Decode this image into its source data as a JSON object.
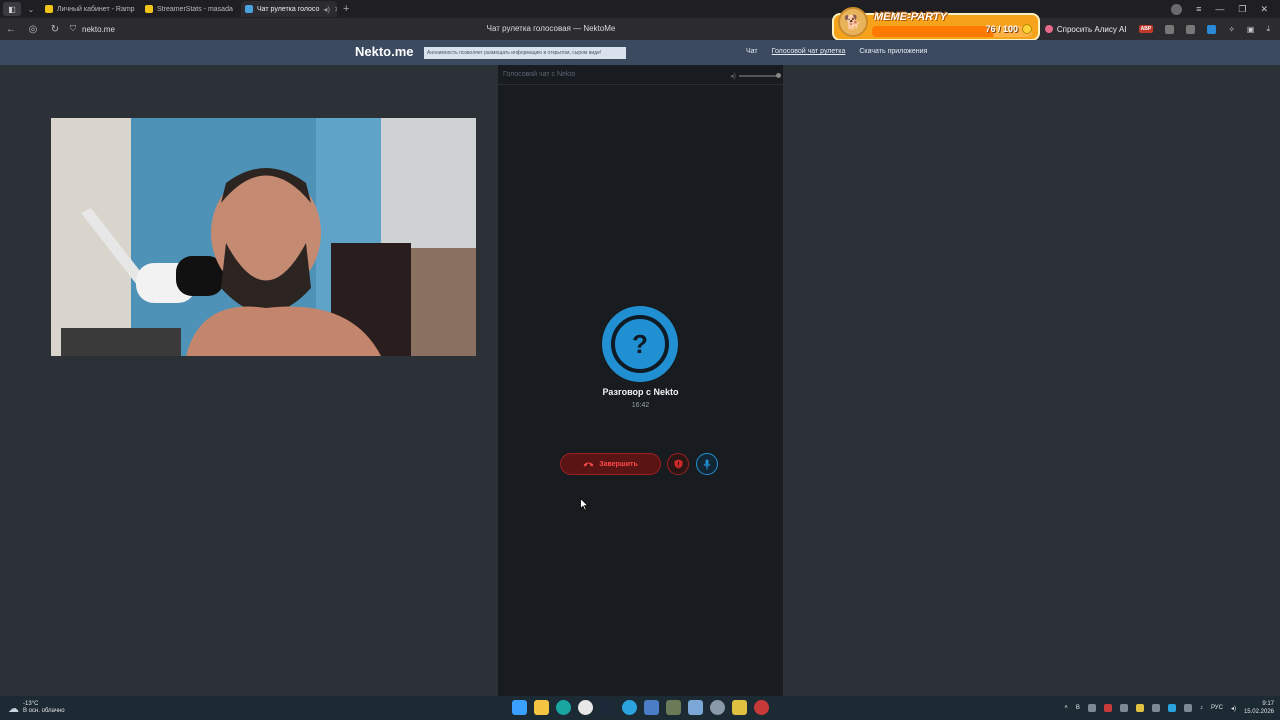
{
  "browser": {
    "tabs": [
      {
        "label": "Личный кабинет - Ramp",
        "favicon_color": "#f0c419",
        "active": false
      },
      {
        "label": "StreamerStats - masada",
        "favicon_color": "#f0c419",
        "active": false
      },
      {
        "label": "Чат рулетка голосо",
        "favicon_color": "#4aa3df",
        "active": true
      }
    ],
    "url": "nekto.me",
    "page_title": "Чат рулетка голосовая — NektoMe",
    "alice_label": "Спросить Алису AI",
    "abp_label": "ABP"
  },
  "meme_party": {
    "title": "MEME-PARTY",
    "count": "76 / 100",
    "progress": 0.76
  },
  "site": {
    "logo": "Nekto.me",
    "notice": "Анонимность позволяет размещать информацию в открытом, сыром виде!",
    "nav": [
      {
        "label": "Чат",
        "active": false
      },
      {
        "label": "Голосовой чат рулетка",
        "active": true
      },
      {
        "label": "Скачать приложения",
        "active": false
      }
    ]
  },
  "chat": {
    "header": "Голосовой чат с Nekto",
    "avatar_symbol": "?",
    "caller": "Разговор с Nekto",
    "timer": "16:42",
    "end_button": "Завершить"
  },
  "taskbar": {
    "temp": "-13°C",
    "weather": "В осн. облачно",
    "lang": "РУС",
    "time": "9:17",
    "date": "15.02.2026",
    "tray_letter": "B"
  },
  "colors": {
    "accent_blue": "#2190d3",
    "end_red": "#ff4a4a",
    "header_bg": "#3b4a5f",
    "panel_bg": "#181b1f"
  }
}
